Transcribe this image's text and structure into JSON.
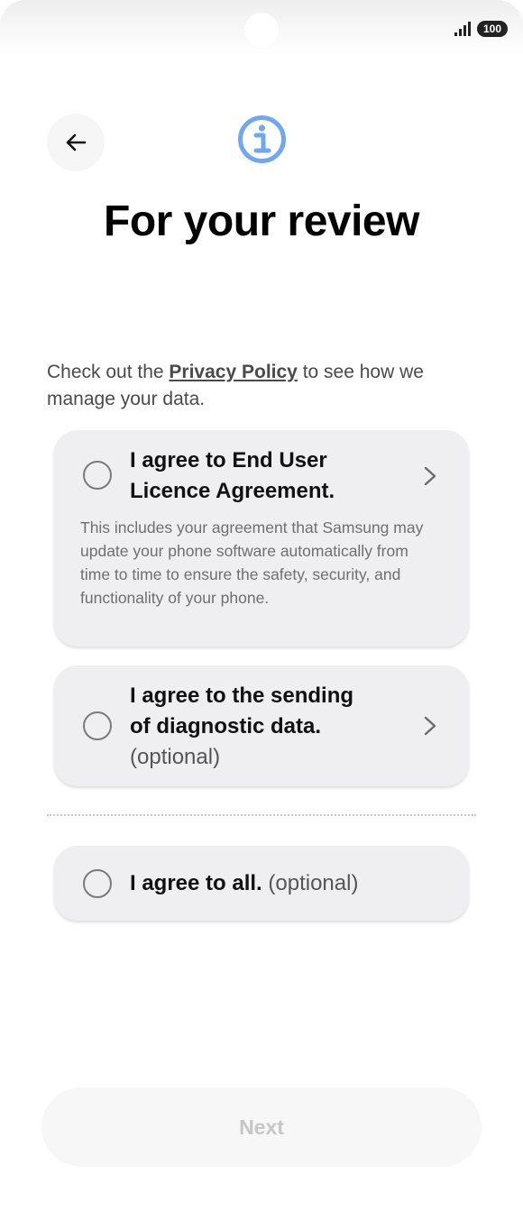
{
  "status_bar": {
    "battery": "100"
  },
  "header": {
    "title": "For your review"
  },
  "intro": {
    "prefix": "Check out the ",
    "link": "Privacy Policy",
    "suffix": " to see how we manage your data."
  },
  "options": {
    "eula": {
      "title_line1": "I agree to End User",
      "title_line2": "Licence Agreement.",
      "description": "This includes your agreement that Samsung may update your phone software automatically from time to time to ensure the safety, security, and functionality of your phone.",
      "checked": false
    },
    "diagnostic": {
      "title_line1": "I agree to the sending",
      "title_line2": "of diagnostic data.",
      "optional": "(optional)",
      "checked": false
    },
    "all": {
      "title": "I agree to all.",
      "optional": "(optional)",
      "checked": false
    }
  },
  "footer": {
    "next_label": "Next",
    "next_enabled": false
  },
  "icons": {
    "back": "arrow-left-icon",
    "info": "info-icon",
    "chevron": "chevron-right-icon",
    "signal": "signal-icon"
  },
  "colors": {
    "accent": "#6fa8ef",
    "card_bg": "#efeff1",
    "disabled_text": "#c6c6c6"
  }
}
